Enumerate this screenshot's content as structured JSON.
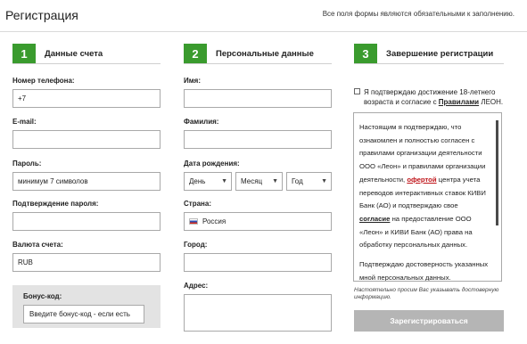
{
  "header": {
    "title": "Регистрация",
    "note": "Все поля формы являются обязательными к заполнению."
  },
  "steps": [
    {
      "number": "1",
      "title": "Данные счета"
    },
    {
      "number": "2",
      "title": "Персональные данные"
    },
    {
      "number": "3",
      "title": "Завершение регистрации"
    }
  ],
  "account": {
    "phone_label": "Номер телефона:",
    "phone_value": "+7",
    "email_label": "E-mail:",
    "email_value": "",
    "password_label": "Пароль:",
    "password_placeholder": "минимум 7 символов",
    "password_confirm_label": "Подтверждение пароля:",
    "password_confirm_value": "",
    "currency_label": "Валюта счета:",
    "currency_value": "RUB",
    "bonus_label": "Бонус-код:",
    "bonus_placeholder": "Введите бонус-код - если есть"
  },
  "personal": {
    "first_name_label": "Имя:",
    "first_name_value": "",
    "last_name_label": "Фамилия:",
    "last_name_value": "",
    "birthdate_label": "Дата рождения:",
    "day_value": "День",
    "month_value": "Месяц",
    "year_value": "Год",
    "country_label": "Страна:",
    "country_value": "Россия",
    "city_label": "Город:",
    "city_value": "",
    "address_label": "Адрес:",
    "address_value": ""
  },
  "completion": {
    "confirm_text": "Я подтверждаю достижение 18-летнего возраста и согласие с",
    "rules_link": "Правилами",
    "brand": "ЛЕОН.",
    "terms_p1_a": "Настоящим я подтверждаю, что ознакомлен и полностью согласен с правилами организации деятельности ООО «Леон» и правилами организации деятельности,",
    "terms_offer_link": "офертой",
    "terms_p1_b": "центра учета переводов интерактивных ставок КИВИ Банк (АО) и подтверждаю свое",
    "terms_consent_link": "согласие",
    "terms_p1_c": "на предоставление ООО «Леон» и КИВИ Банк (АО) права на обработку персональных данных.",
    "terms_p2": "Подтверждаю достоверность указанных мной персональных данных.",
    "small_note": "Настоятельно просим Вас указывать достоверную информацию.",
    "submit_label": "Зарегистрироваться"
  },
  "colors": {
    "accent": "#3a9b2e",
    "button_disabled": "#b5b5b5",
    "link_red": "#c0161b"
  }
}
